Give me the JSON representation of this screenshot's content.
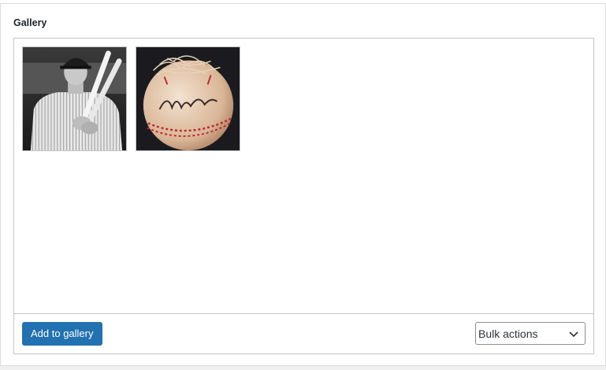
{
  "gallery": {
    "label": "Gallery",
    "images": [
      {
        "name": "babe-ruth-photo",
        "alt": "Player holding bats"
      },
      {
        "name": "signed-baseball-photo",
        "alt": "Signed baseball"
      }
    ],
    "add_button_label": "Add to gallery",
    "bulk_actions": {
      "selected": "Bulk actions"
    }
  },
  "colors": {
    "primary_button": "#2271b1",
    "border": "#c3c4c7"
  },
  "icons": {
    "select_arrow": "chevron-down-icon"
  }
}
